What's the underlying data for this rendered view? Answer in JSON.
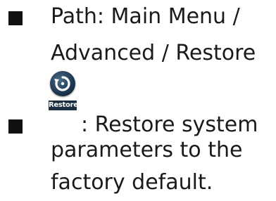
{
  "items": [
    {
      "lines": [
        "Path: Main Menu /",
        "Advanced / Restore"
      ]
    },
    {
      "icon_label": "Restore",
      "icon_name": "restore-icon",
      "first_line": ": Restore system",
      "lines": [
        "parameters to the",
        "factory default."
      ]
    }
  ]
}
